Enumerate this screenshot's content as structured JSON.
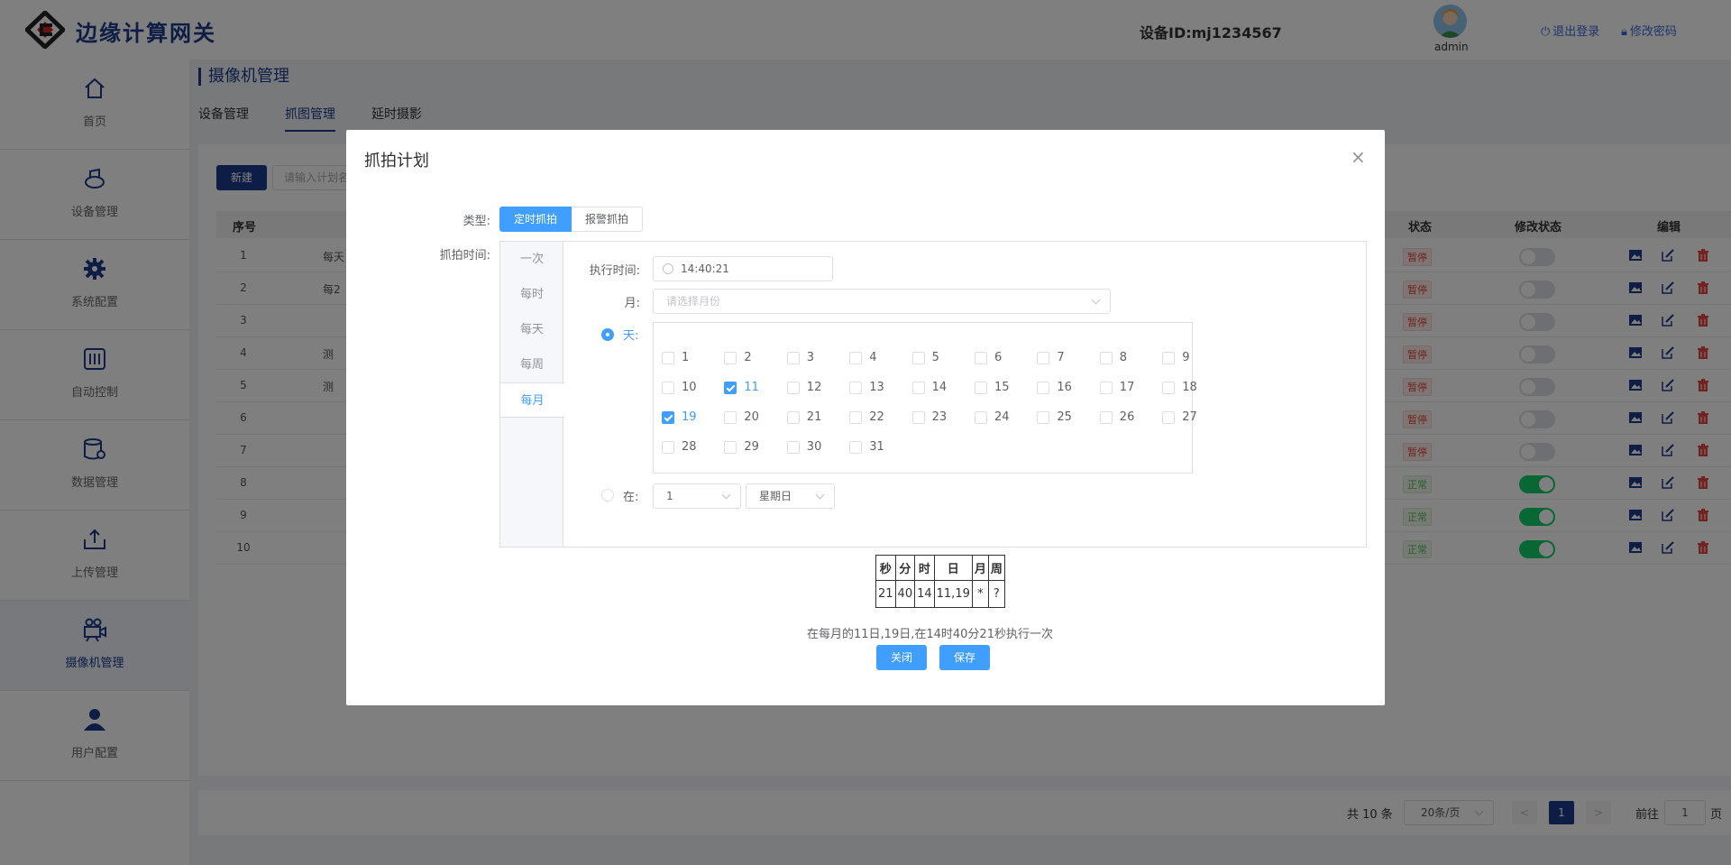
{
  "header": {
    "app_title": "边缘计算网关",
    "device_id": "设备ID:mj1234567",
    "user": "admin",
    "logout": "退出登录",
    "change_password": "修改密码"
  },
  "sidebar": {
    "items": [
      {
        "label": "首页",
        "icon": "home-icon"
      },
      {
        "label": "设备管理",
        "icon": "device-icon"
      },
      {
        "label": "系统配置",
        "icon": "gear-icon"
      },
      {
        "label": "自动控制",
        "icon": "sliders-icon"
      },
      {
        "label": "数据管理",
        "icon": "database-icon"
      },
      {
        "label": "上传管理",
        "icon": "upload-icon"
      },
      {
        "label": "摄像机管理",
        "icon": "camera-icon"
      },
      {
        "label": "用户配置",
        "icon": "user-icon"
      }
    ]
  },
  "page": {
    "title": "摄像机管理",
    "tabs": [
      "设备管理",
      "抓图管理",
      "延时摄影"
    ],
    "new_button": "新建",
    "search_placeholder": "请输入计划名"
  },
  "table": {
    "columns": [
      "序号",
      "状态",
      "修改状态",
      "编辑"
    ],
    "rows": [
      {
        "idx": "1",
        "name": "每天",
        "status": "暂停",
        "on": false
      },
      {
        "idx": "2",
        "name": "每2",
        "status": "暂停",
        "on": false
      },
      {
        "idx": "3",
        "name": "",
        "status": "暂停",
        "on": false
      },
      {
        "idx": "4",
        "name": "测",
        "status": "暂停",
        "on": false
      },
      {
        "idx": "5",
        "name": "测",
        "status": "暂停",
        "on": false
      },
      {
        "idx": "6",
        "name": "",
        "status": "暂停",
        "on": false
      },
      {
        "idx": "7",
        "name": "",
        "status": "暂停",
        "on": false
      },
      {
        "idx": "8",
        "name": "",
        "status": "正常",
        "on": true
      },
      {
        "idx": "9",
        "name": "",
        "status": "正常",
        "on": true
      },
      {
        "idx": "10",
        "name": "",
        "status": "正常",
        "on": true
      }
    ]
  },
  "pagination": {
    "total": "共 10 条",
    "page_size": "20条/页",
    "prev": "<",
    "current": "1",
    "next": ">",
    "goto_label": "前往",
    "goto_value": "1",
    "goto_suffix": "页"
  },
  "dialog": {
    "title": "抓拍计划",
    "close": "×",
    "type_label": "类型:",
    "type_options": [
      "定时抓拍",
      "报警抓拍"
    ],
    "time_label": "抓拍时间:",
    "freq_tabs": [
      "一次",
      "每时",
      "每天",
      "每周",
      "每月"
    ],
    "exec_time_label": "执行时间:",
    "exec_time_value": "14:40:21",
    "month_label": "月:",
    "month_placeholder": "请选择月份",
    "day_label": "天:",
    "days": [
      "1",
      "2",
      "3",
      "4",
      "5",
      "6",
      "7",
      "8",
      "9",
      "10",
      "11",
      "12",
      "13",
      "14",
      "15",
      "16",
      "17",
      "18",
      "19",
      "20",
      "21",
      "22",
      "23",
      "24",
      "25",
      "26",
      "27",
      "28",
      "29",
      "30",
      "31"
    ],
    "checked_days": [
      "11",
      "19"
    ],
    "at_label": "在:",
    "week_num": "1",
    "week_day": "星期日",
    "cron_headers": [
      "秒",
      "分",
      "时",
      "日",
      "月",
      "周"
    ],
    "cron_values": [
      "21",
      "40",
      "14",
      "11,19",
      "*",
      "?"
    ],
    "description": "在每月的11日,19日,在14时40分21秒执行一次",
    "close_button": "关闭",
    "save_button": "保存"
  },
  "colors": {
    "brand": "#1a3a8a",
    "primary": "#409eff",
    "danger": "#e0463e",
    "success": "#13ce66"
  }
}
